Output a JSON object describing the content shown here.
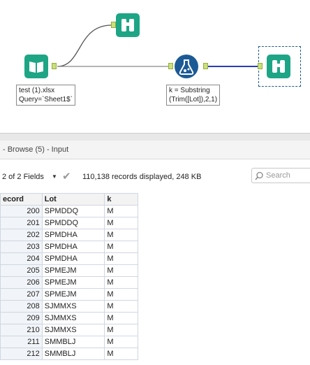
{
  "canvas": {
    "input_tool_annotation": "test (1).xlsx\nQuery=`Sheet1$`",
    "formula_tool_annotation": "k = Substring\n(Trim([Lot]),2,1)"
  },
  "results_window": {
    "title": "- Browse (5) - Input",
    "fields_selector": "2 of 2 Fields",
    "record_info": "110,138 records displayed, 248 KB",
    "search_placeholder": "Search"
  },
  "table": {
    "columns": [
      "ecord",
      "Lot",
      "k"
    ],
    "rows": [
      {
        "record": "200",
        "lot": "SPMDDQ",
        "k": "M"
      },
      {
        "record": "201",
        "lot": "SPMDDQ",
        "k": "M"
      },
      {
        "record": "202",
        "lot": "SPMDHA",
        "k": "M"
      },
      {
        "record": "203",
        "lot": "SPMDHA",
        "k": "M"
      },
      {
        "record": "204",
        "lot": "SPMDHA",
        "k": "M"
      },
      {
        "record": "205",
        "lot": "SPMEJM",
        "k": "M"
      },
      {
        "record": "206",
        "lot": "SPMEJM",
        "k": "M"
      },
      {
        "record": "207",
        "lot": "SPMEJM",
        "k": "M"
      },
      {
        "record": "208",
        "lot": "SJMMXS",
        "k": "M"
      },
      {
        "record": "209",
        "lot": "SJMMXS",
        "k": "M"
      },
      {
        "record": "210",
        "lot": "SJMMXS",
        "k": "M"
      },
      {
        "record": "211",
        "lot": "SMMBLJ",
        "k": "M"
      },
      {
        "record": "212",
        "lot": "SMMBLJ",
        "k": "M"
      }
    ]
  },
  "colors": {
    "browse_tool": "#1ea585",
    "formula_tool": "#1c5a96",
    "connection_selected": "#2a3bb8",
    "anchor": "#c9e07d"
  }
}
